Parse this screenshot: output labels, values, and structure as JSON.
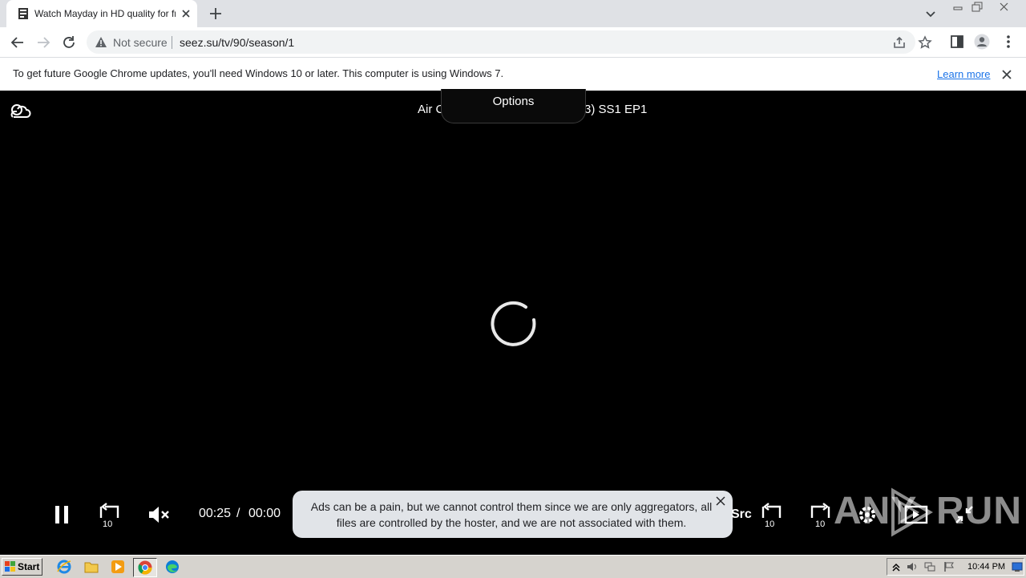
{
  "browser": {
    "tab_title": "Watch Mayday in HD quality for free",
    "security_label": "Not secure",
    "url": "seez.su/tv/90/season/1"
  },
  "infobar": {
    "message": "To get future Google Chrome updates, you'll need Windows 10 or later. This computer is using Windows 7.",
    "link_label": "Learn more"
  },
  "player": {
    "title_left": "Air C",
    "title_right": "3) SS1 EP1",
    "options_label": "Options",
    "current_time": "00:25",
    "time_separator": "/",
    "duration": "00:00",
    "source_label": "Src",
    "ad_notice": "Ads can be a pain, but we cannot control them since we are only aggregators, all files are controlled by the hoster, and we are not associated with them."
  },
  "watermark": {
    "left": "ANY",
    "right": "RUN"
  },
  "taskbar": {
    "start_label": "Start",
    "clock": "10:44 PM"
  },
  "colors": {
    "chrome_frame": "#dfe1e5",
    "link": "#1a73e8",
    "player_bg": "#000000",
    "taskbar": "#d6d3ce"
  },
  "icons": {
    "favicon": "site-favicon-icon",
    "cloud": "cloud-icon",
    "pause": "pause-icon",
    "rewind": "rewind-10-icon",
    "mute": "volume-muted-icon",
    "forward": "forward-10-icon",
    "settings": "gear-icon",
    "fullscreen": "exit-fullscreen-icon"
  }
}
